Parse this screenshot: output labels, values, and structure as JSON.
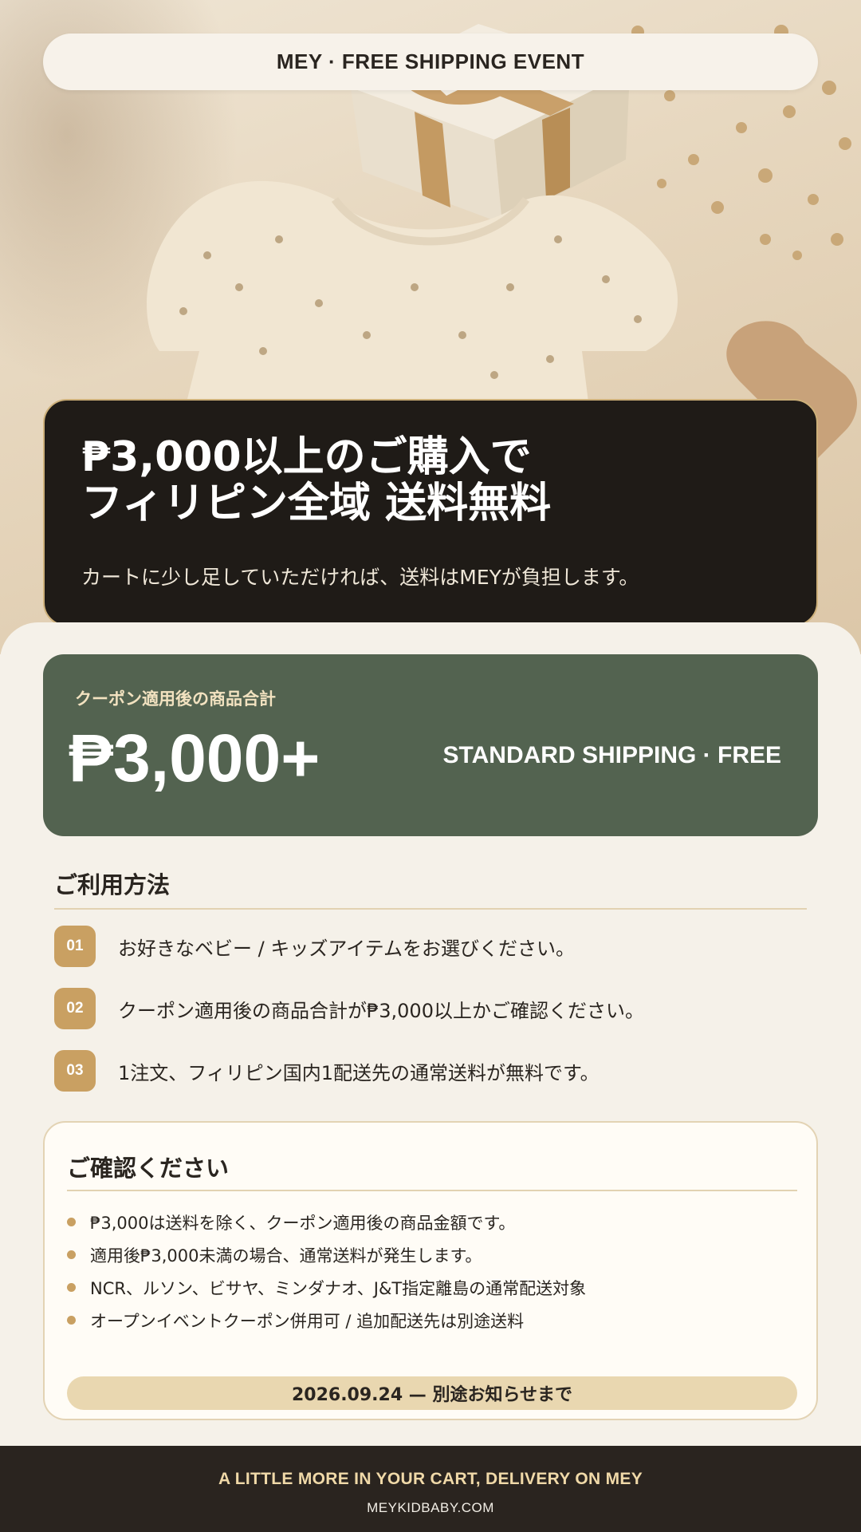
{
  "event_banner": {
    "title": "MEY · FREE SHIPPING EVENT"
  },
  "hero": {
    "headline_line1": "₱3,000以上のご購入で",
    "headline_line2": "フィリピン全域 送料無料",
    "subtext": "カートに少し足していただければ、送料はMEYが負担します。",
    "image_subject": "baby floral dress, gift box with ribbon, dried flowers, wooden toy"
  },
  "price_card": {
    "label": "クーポン適用後の商品合計",
    "value": "₱3,000+",
    "note": "STANDARD SHIPPING · FREE"
  },
  "how_to": {
    "title": "ご利用方法",
    "steps": [
      {
        "num": "01",
        "text": "お好きなベビー / キッズアイテムをお選びください。"
      },
      {
        "num": "02",
        "text": "クーポン適用後の商品合計が₱3,000以上かご確認ください。"
      },
      {
        "num": "03",
        "text": "1注文、フィリピン国内1配送先の通常送料が無料です。"
      }
    ]
  },
  "notice": {
    "title": "ご確認ください",
    "items": [
      "₱3,000は送料を除く、クーポン適用後の商品金額です。",
      "適用後₱3,000未満の場合、通常送料が発生します。",
      "NCR、ルソン、ビサヤ、ミンダナオ、J&T指定離島の通常配送対象",
      "オープンイベントクーポン併用可 / 追加配送先は別途送料"
    ],
    "deadline": "2026.09.24 — 別途お知らせまで"
  },
  "footer": {
    "tagline": "A LITTLE MORE IN YOUR CART, DELIVERY ON MEY",
    "url": "MEYKIDBABY.COM"
  },
  "colors": {
    "background": "#f5f1e9",
    "dark": "#1f1b17",
    "green": "#536350",
    "gold": "#c9a062",
    "gold_light": "#e9d7b0"
  }
}
